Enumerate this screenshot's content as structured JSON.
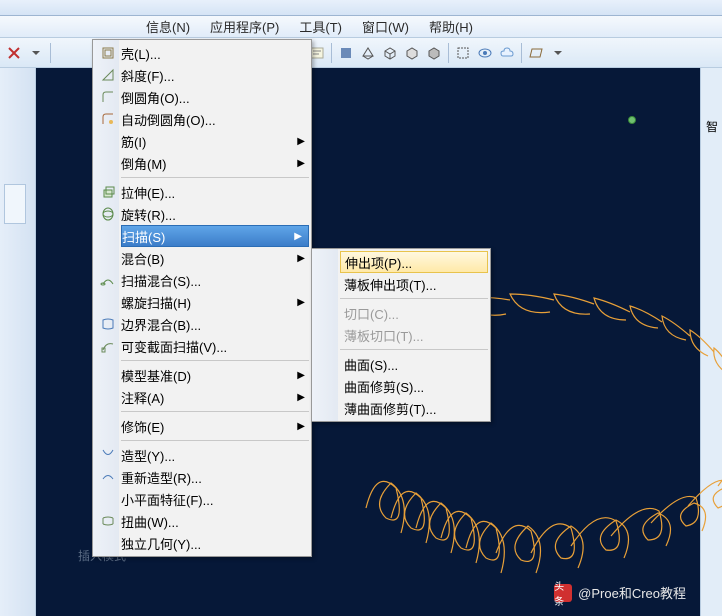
{
  "menubar": {
    "items": [
      "信息(N)",
      "应用程序(P)",
      "工具(T)",
      "窗口(W)",
      "帮助(H)"
    ]
  },
  "rightLabel": "智",
  "statusText": "插入模式",
  "watermark": {
    "logo": "头条",
    "text": "@Proe和Creo教程"
  },
  "contextMenu": {
    "groups": [
      [
        {
          "label": "壳(L)...",
          "icon": "shell"
        },
        {
          "label": "斜度(F)...",
          "icon": "slope"
        },
        {
          "label": "倒圆角(O)...",
          "icon": "round"
        },
        {
          "label": "自动倒圆角(O)...",
          "icon": "autoround"
        },
        {
          "label": "筋(I)",
          "arrow": true
        },
        {
          "label": "倒角(M)",
          "arrow": true
        }
      ],
      [
        {
          "label": "拉伸(E)...",
          "icon": "extrude"
        },
        {
          "label": "旋转(R)...",
          "icon": "revolve"
        },
        {
          "label": "扫描(S)",
          "arrow": true,
          "highlighted": true
        },
        {
          "label": "混合(B)",
          "arrow": true
        },
        {
          "label": "扫描混合(S)...",
          "icon": "sweepblend"
        },
        {
          "label": "螺旋扫描(H)",
          "arrow": true
        },
        {
          "label": "边界混合(B)...",
          "icon": "boundary"
        },
        {
          "label": "可变截面扫描(V)...",
          "icon": "varsweep"
        }
      ],
      [
        {
          "label": "模型基准(D)",
          "arrow": true
        },
        {
          "label": "注释(A)",
          "arrow": true
        }
      ],
      [
        {
          "label": "修饰(E)",
          "arrow": true
        }
      ],
      [
        {
          "label": "造型(Y)...",
          "icon": "style"
        },
        {
          "label": "重新造型(R)...",
          "icon": "restyle"
        },
        {
          "label": "小平面特征(F)..."
        },
        {
          "label": "扭曲(W)...",
          "icon": "warp"
        },
        {
          "label": "独立几何(Y)..."
        }
      ]
    ]
  },
  "submenu": {
    "items": [
      {
        "label": "伸出项(P)...",
        "highlighted": true
      },
      {
        "label": "薄板伸出项(T)..."
      },
      {
        "label": "切口(C)...",
        "disabled": true
      },
      {
        "label": "薄板切口(T)...",
        "disabled": true
      },
      {
        "label": "曲面(S)..."
      },
      {
        "label": "曲面修剪(S)..."
      },
      {
        "label": "薄曲面修剪(T)..."
      }
    ]
  }
}
